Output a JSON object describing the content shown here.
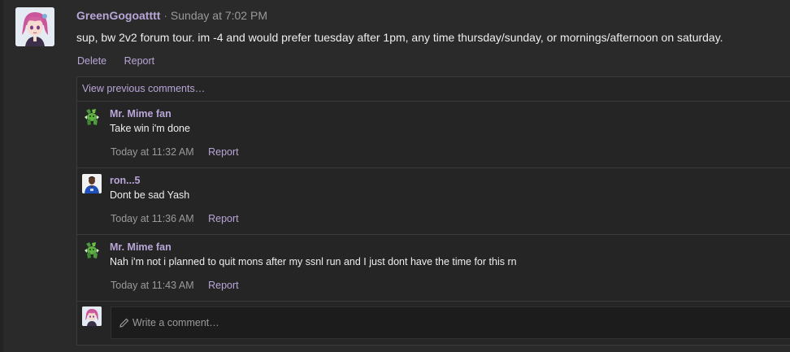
{
  "post": {
    "author": "GreenGogoatttt",
    "separator": "·",
    "time": "Sunday at 7:02 PM",
    "body": "sup, bw 2v2 forum tour. im -4 and would prefer tuesday after 1pm, any time thursday/sunday, or mornings/afternoon on saturday.",
    "actions": {
      "delete": "Delete",
      "report": "Report"
    }
  },
  "comments": {
    "view_previous": "View previous comments…",
    "items": [
      {
        "author": "Mr. Mime fan",
        "text": "Take win i'm done",
        "time": "Today at 11:32 AM",
        "report": "Report",
        "avatar": "green-sprite-avatar"
      },
      {
        "author": "ron...5",
        "text": "Dont be sad Yash",
        "time": "Today at 11:36 AM",
        "report": "Report",
        "avatar": "blue-jersey-avatar"
      },
      {
        "author": "Mr. Mime fan",
        "text": "Nah i'm not i planned to quit mons after my ssnl run and I just dont have the time for this rn",
        "time": "Today at 11:43 AM",
        "report": "Report",
        "avatar": "green-sprite-avatar"
      }
    ],
    "write_placeholder": "Write a comment…"
  },
  "colors": {
    "background": "#2a2a2a",
    "panel": "#252525",
    "accent_link": "#b9a6d8",
    "text": "#eeeeee",
    "muted": "#9a9a9a"
  }
}
